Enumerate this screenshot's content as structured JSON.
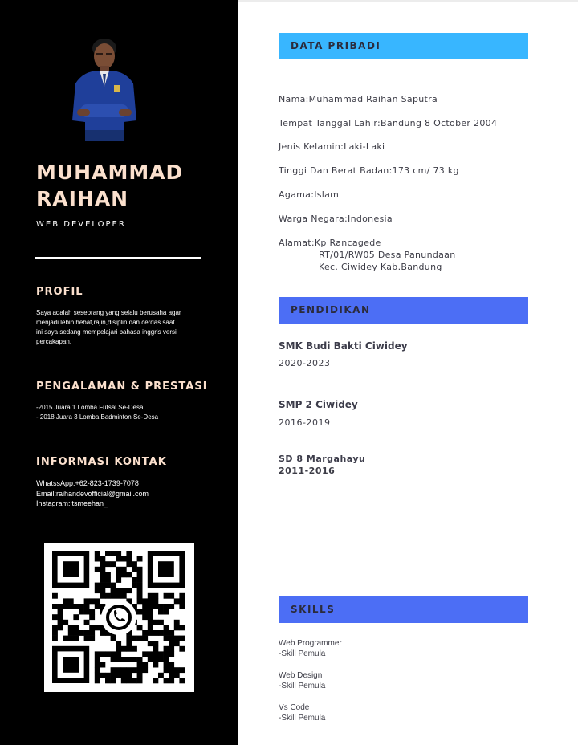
{
  "profile": {
    "first_name": "MUHAMMAD",
    "last_name": "RAIHAN",
    "role": "WEB DEVELOPER"
  },
  "left": {
    "profil": {
      "heading": "PROFIL",
      "lines": [
        "Saya adalah seseorang yang selalu berusaha agar",
        "menjadi lebih hebat,rajin,disiplin,dan cerdas.saat",
        "ini saya sedang mempelajari bahasa inggris versi",
        "percakapan."
      ]
    },
    "pengalaman": {
      "heading": "PENGALAMAN & PRESTASI",
      "items": [
        "-2015 Juara 1 Lomba Futsal Se-Desa",
        "- 2018 Juara 3 Lomba Badminton Se-Desa"
      ]
    },
    "kontak": {
      "heading": "INFORMASI KONTAK",
      "items": [
        "WhatssApp:+62-823-1739-7078",
        "Email:raihandevofficial@gmail.com",
        "Instagram:itsmeehan_"
      ]
    }
  },
  "data_pribadi": {
    "heading": "DATA PRIBADI",
    "nama": "Nama:Muhammad Raihan Saputra",
    "ttl": "Tempat Tanggal Lahir:Bandung 8 October 2004",
    "jk": "Jenis Kelamin:Laki-Laki",
    "tb": "Tinggi Dan Berat Badan:173 cm/ 73 kg",
    "agama": "Agama:Islam",
    "wn": "Warga Negara:Indonesia",
    "alamat": "Alamat:Kp Rancagede",
    "alamat_2": "RT/01/RW05 Desa Panundaan",
    "alamat_3": "Kec. Ciwidey Kab.Bandung"
  },
  "pendidikan": {
    "heading": "PENDIDIKAN",
    "schools": [
      {
        "name": "SMK Budi Bakti Ciwidey",
        "years": "2020-2023"
      },
      {
        "name": "SMP 2 Ciwidey",
        "years": "2016-2019"
      },
      {
        "name": "SD 8 Margahayu",
        "years": "2011-2016"
      }
    ]
  },
  "skills": {
    "heading": "SKILLS",
    "items": [
      {
        "name": "Web Programmer",
        "level": "-Skill Pemula"
      },
      {
        "name": "Web Design",
        "level": "-Skill Pemula"
      },
      {
        "name": "Vs Code",
        "level": "-Skill Pemula"
      }
    ]
  },
  "colors": {
    "sidebar": "#000000",
    "name_accent": "#fbe0cd",
    "bar_blue": "#38b6ff",
    "bar_indigo": "#4c6ef5"
  },
  "icons": [
    "whatsapp-icon",
    "qr-code"
  ]
}
